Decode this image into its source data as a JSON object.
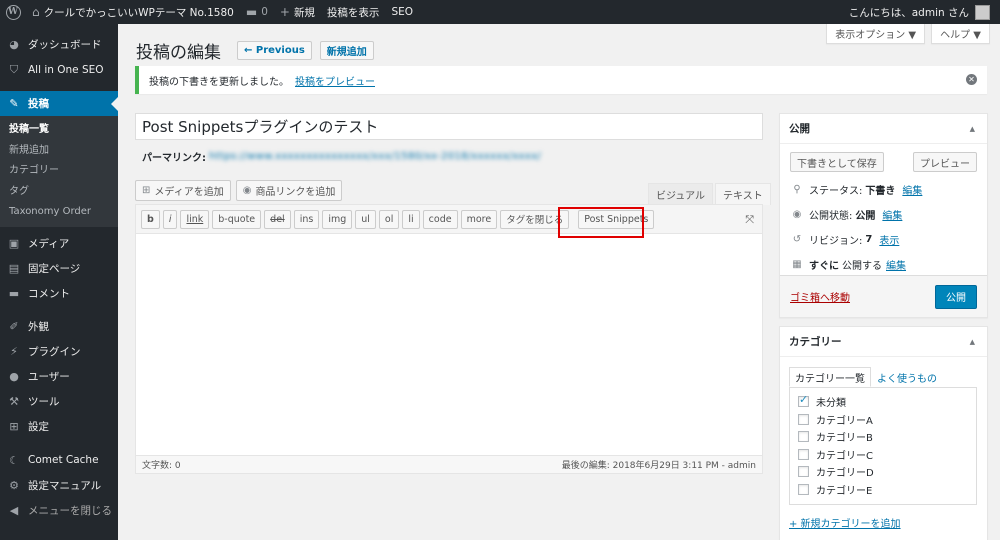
{
  "adminbar": {
    "site_name": "クールでかっこいいWPテーマ No.1580",
    "comments_count": "0",
    "new_label": "新規",
    "view_post": "投稿を表示",
    "seo": "SEO",
    "greeting": "こんにちは、admin さん"
  },
  "sidebar": {
    "items": [
      {
        "label": "ダッシュボード",
        "icon": "dashboard-icon",
        "glyph": "◕"
      },
      {
        "label": "All in One SEO",
        "icon": "shield-icon",
        "glyph": "⛉"
      },
      {
        "label": "投稿",
        "icon": "pin-icon",
        "glyph": "✎"
      },
      {
        "label": "メディア",
        "icon": "media-icon",
        "glyph": "▣"
      },
      {
        "label": "固定ページ",
        "icon": "page-icon",
        "glyph": "▤"
      },
      {
        "label": "コメント",
        "icon": "comment-icon",
        "glyph": "▬"
      },
      {
        "label": "外観",
        "icon": "brush-icon",
        "glyph": "✐"
      },
      {
        "label": "プラグイン",
        "icon": "plugin-icon",
        "glyph": "⚡"
      },
      {
        "label": "ユーザー",
        "icon": "user-icon",
        "glyph": "●"
      },
      {
        "label": "ツール",
        "icon": "wrench-icon",
        "glyph": "⚒"
      },
      {
        "label": "設定",
        "icon": "settings-icon",
        "glyph": "⊞"
      },
      {
        "label": "Comet Cache",
        "icon": "comet-icon",
        "glyph": "☾"
      },
      {
        "label": "設定マニュアル",
        "icon": "gear-icon",
        "glyph": "⚙"
      },
      {
        "label": "メニューを閉じる",
        "icon": "collapse-icon",
        "glyph": "◀"
      }
    ],
    "submenu": [
      "投稿一覧",
      "新規追加",
      "カテゴリー",
      "タグ",
      "Taxonomy Order"
    ]
  },
  "screen_options": {
    "display": "表示オプション ▼",
    "help": "ヘルプ ▼"
  },
  "page": {
    "title": "投稿の編集",
    "prev_button": "← Previous",
    "add_new": "新規追加"
  },
  "notice": {
    "text": "投稿の下書きを更新しました。",
    "link": "投稿をプレビュー"
  },
  "post": {
    "title": "Post Snippetsプラグインのテスト",
    "permalink_label": "パーマリンク:",
    "permalink_url": "https://www.xxxxxxxxxxxxxxx/xxx/1580/xx-2018/xxxxxx/xxxx/"
  },
  "media": {
    "add_media": "メディアを追加",
    "add_product": "商品リンクを追加"
  },
  "editor": {
    "tab_visual": "ビジュアル",
    "tab_text": "テキスト",
    "quicktags": [
      "b",
      "i",
      "link",
      "b-quote",
      "del",
      "ins",
      "img",
      "ul",
      "ol",
      "li",
      "code",
      "more",
      "タグを閉じる",
      "Post Snippets"
    ],
    "word_count": "文字数: 0",
    "last_edit": "最後の編集: 2018年6月29日 3:11 PM - admin",
    "highlight_color": "#e00000"
  },
  "publish": {
    "title": "公開",
    "save_draft": "下書きとして保存",
    "preview": "プレビュー",
    "status_label": "ステータス:",
    "status_value": "下書き",
    "visibility_label": "公開状態:",
    "visibility_value": "公開",
    "revisions_label": "リビジョン:",
    "revisions_value": "7",
    "revisions_link": "表示",
    "schedule_label": "すぐに",
    "schedule_value": "公開する",
    "edit": "編集",
    "trash": "ゴミ箱へ移動",
    "publish_button": "公開"
  },
  "category": {
    "title": "カテゴリー",
    "tab_all": "カテゴリー一覧",
    "tab_popular": "よく使うもの",
    "items": [
      {
        "label": "未分類",
        "checked": true
      },
      {
        "label": "カテゴリーA",
        "checked": false
      },
      {
        "label": "カテゴリーB",
        "checked": false
      },
      {
        "label": "カテゴリーC",
        "checked": false
      },
      {
        "label": "カテゴリーD",
        "checked": false
      },
      {
        "label": "カテゴリーE",
        "checked": false
      }
    ],
    "add_new": "+ 新規カテゴリーを追加"
  }
}
